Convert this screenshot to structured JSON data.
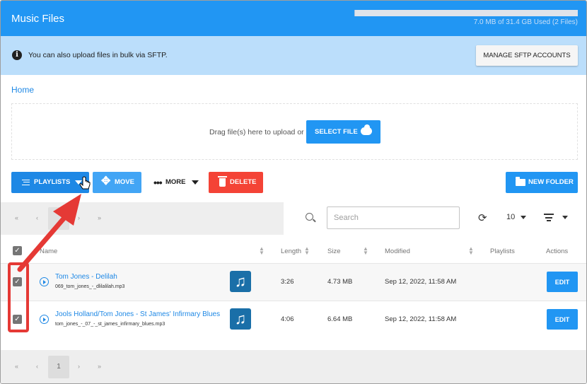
{
  "header": {
    "title": "Music Files",
    "storage_text": "7.0 MB of 31.4 GB Used (2 Files)",
    "storage_fraction": 0.0003
  },
  "info": {
    "text": "You can also upload files in bulk via SFTP.",
    "button": "MANAGE SFTP ACCOUNTS"
  },
  "breadcrumb": "Home",
  "dropzone": {
    "text": "Drag file(s) here to upload or",
    "button": "SELECT FILE"
  },
  "toolbar": {
    "playlists": "PLAYLISTS",
    "move": "MOVE",
    "more": "MORE",
    "delete": "DELETE",
    "new_folder": "NEW FOLDER"
  },
  "pager": {
    "first": "«",
    "prev": "‹",
    "next": "›",
    "last": "»",
    "current": "1"
  },
  "search": {
    "placeholder": "Search"
  },
  "per_page": "10",
  "table": {
    "columns": {
      "name": "Name",
      "length": "Length",
      "size": "Size",
      "modified": "Modified",
      "playlists": "Playlists",
      "actions": "Actions"
    },
    "rows": [
      {
        "title": "Tom Jones - Delilah",
        "file": "069_tom_jones_-_dlilalilah.mp3",
        "length": "3:26",
        "size": "4.73 MB",
        "modified": "Sep 12, 2022, 11:58 AM",
        "playlists": "",
        "action": "EDIT",
        "checked": true
      },
      {
        "title": "Jools Holland/Tom Jones - St James' Infirmary Blues",
        "file": "tom_jones_-_07_-_st_james_infirmary_blues.mp3",
        "length": "4:06",
        "size": "6.64 MB",
        "modified": "Sep 12, 2022, 11:58 AM",
        "playlists": "",
        "action": "EDIT",
        "checked": true
      }
    ]
  },
  "colors": {
    "header": "#2196f3",
    "info": "#bbdefb",
    "delete": "#f44336",
    "highlight": "#e53935"
  },
  "icons": [
    "info-icon",
    "upload-cloud-icon",
    "list-icon",
    "move-icon",
    "more-dots-icon",
    "trash-icon",
    "folder-icon",
    "search-icon",
    "refresh-icon",
    "sort-icon",
    "play-icon",
    "music-note-icon",
    "checkbox-icon",
    "pointer-cursor-icon",
    "annotation-arrow"
  ]
}
